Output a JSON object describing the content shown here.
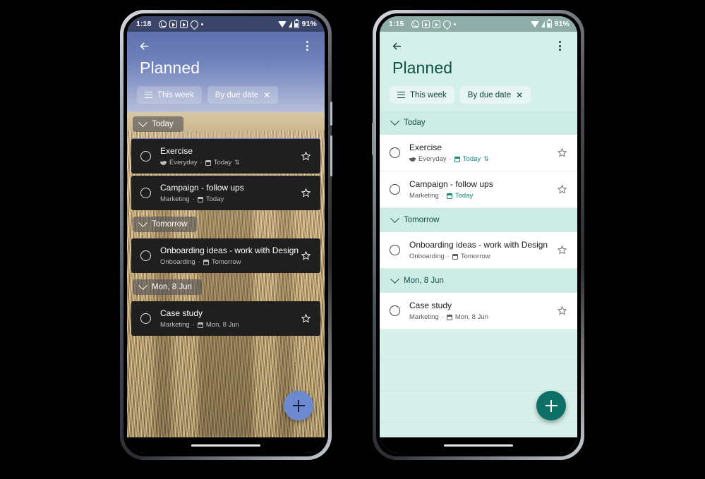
{
  "phones": [
    {
      "id": "left",
      "theme": "dark-wallpaper",
      "status_bar": {
        "time": "1:18",
        "battery_percent": "91%",
        "icons_left": [
          "whatsapp-icon",
          "app-icon",
          "app-icon",
          "location-pin-icon",
          "dot-icon"
        ],
        "icons_right": [
          "wifi-icon",
          "signal-icon",
          "battery-icon"
        ]
      },
      "app_bar": {
        "back_icon": "back-arrow-icon",
        "overflow_icon": "more-vert-icon"
      },
      "title": "Planned",
      "chips": [
        {
          "label": "This week",
          "leading_icon": "list-lines-icon",
          "trailing_icon": null
        },
        {
          "label": "By due date",
          "leading_icon": null,
          "trailing_icon": "close-icon"
        }
      ],
      "groups": [
        {
          "label": "Today",
          "tasks": [
            {
              "title": "Exercise",
              "list": "Everyday",
              "due": "Today",
              "list_icon": "bowl-icon",
              "due_icon": "calendar-icon",
              "repeat_icon": "repeat-icon",
              "starred": false
            },
            {
              "title": "Campaign - follow ups",
              "list": "Marketing",
              "due": "Today",
              "list_icon": null,
              "due_icon": "calendar-icon",
              "repeat_icon": null,
              "starred": false
            }
          ]
        },
        {
          "label": "Tomorrow",
          "tasks": [
            {
              "title": "Onboarding ideas - work with Design",
              "list": "Onboarding",
              "due": "Tomorrow",
              "list_icon": null,
              "due_icon": "calendar-icon",
              "repeat_icon": null,
              "starred": false
            }
          ]
        },
        {
          "label": "Mon, 8 Jun",
          "tasks": [
            {
              "title": "Case study",
              "list": "Marketing",
              "due": "Mon, 8 Jun",
              "list_icon": null,
              "due_icon": "calendar-icon",
              "repeat_icon": null,
              "starred": false
            }
          ]
        }
      ],
      "fab": {
        "icon": "plus-icon",
        "color": "#6d8ad1"
      },
      "colors": {
        "accent": "#6d8ad1",
        "header": "#5e70ad",
        "card": "#1f1f1f"
      }
    },
    {
      "id": "right",
      "theme": "light-mint",
      "status_bar": {
        "time": "1:15",
        "battery_percent": "91%",
        "icons_left": [
          "whatsapp-icon",
          "app-icon",
          "app-icon",
          "location-pin-icon",
          "dot-icon"
        ],
        "icons_right": [
          "wifi-icon",
          "signal-icon",
          "battery-icon"
        ]
      },
      "app_bar": {
        "back_icon": "back-arrow-icon",
        "overflow_icon": "more-vert-icon"
      },
      "title": "Planned",
      "chips": [
        {
          "label": "This week",
          "leading_icon": "list-lines-icon",
          "trailing_icon": null
        },
        {
          "label": "By due date",
          "leading_icon": null,
          "trailing_icon": "close-icon"
        }
      ],
      "groups": [
        {
          "label": "Today",
          "tasks": [
            {
              "title": "Exercise",
              "list": "Everyday",
              "due": "Today",
              "list_icon": "bowl-icon",
              "due_icon": "calendar-icon",
              "repeat_icon": "repeat-icon",
              "due_accent": true,
              "starred": false
            },
            {
              "title": "Campaign - follow ups",
              "list": "Marketing",
              "due": "Today",
              "list_icon": null,
              "due_icon": "calendar-icon",
              "repeat_icon": null,
              "due_accent": true,
              "starred": false
            }
          ]
        },
        {
          "label": "Tomorrow",
          "tasks": [
            {
              "title": "Onboarding ideas - work with Design",
              "list": "Onboarding",
              "due": "Tomorrow",
              "list_icon": null,
              "due_icon": "calendar-icon",
              "repeat_icon": null,
              "due_accent": false,
              "starred": false
            }
          ]
        },
        {
          "label": "Mon, 8 Jun",
          "tasks": [
            {
              "title": "Case study",
              "list": "Marketing",
              "due": "Mon, 8 Jun",
              "list_icon": null,
              "due_icon": "calendar-icon",
              "repeat_icon": null,
              "due_accent": false,
              "starred": false
            }
          ]
        }
      ],
      "fab": {
        "icon": "plus-icon",
        "color": "#0d7066"
      },
      "colors": {
        "accent": "#0d7066",
        "header": "#d5efe9",
        "card": "#ffffff"
      }
    }
  ]
}
